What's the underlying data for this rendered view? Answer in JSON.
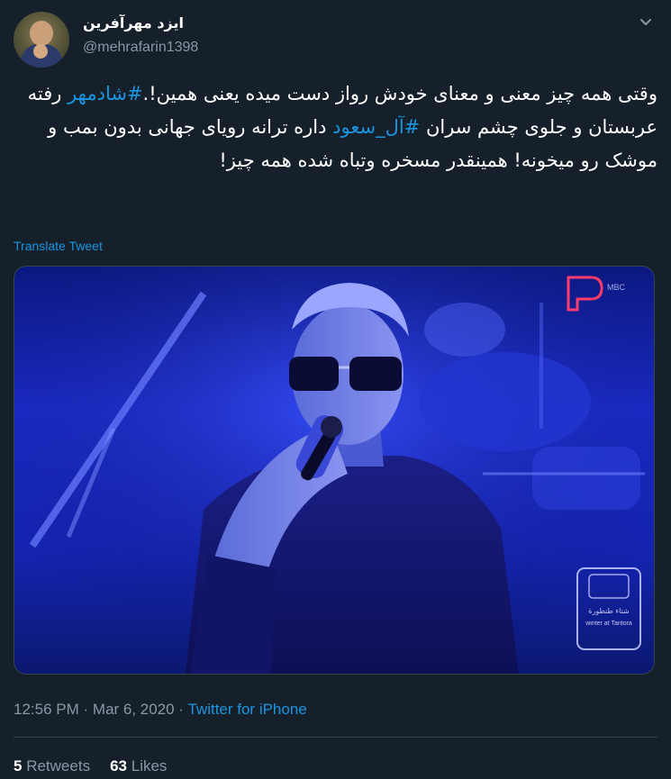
{
  "author": {
    "name": "ایزد مهرآفرین",
    "handle": "@mehrafarin1398"
  },
  "tweet": {
    "text_before_tag1": "وقتی همه چیز معنی و معنای خودش رواز دست میده یعنی همین!.",
    "hashtag1": "#شادمهر",
    "text_middle": " رفته عربستان و جلوی چشم سران ",
    "hashtag2": "#آل_سعود",
    "text_after": " داره ترانه رویای جهانی بدون بمب و موشک رو میخونه! همینقدر مسخره وتباه شده همه چیز!"
  },
  "translate_label": "Translate Tweet",
  "media": {
    "watermark_text": "MBC",
    "badge_text_line1": "شتاء طنطورة",
    "badge_text_line2": "winter at Tantora"
  },
  "meta": {
    "time": "12:56 PM",
    "separator": "·",
    "date": "Mar 6, 2020",
    "source": "Twitter for iPhone"
  },
  "stats": {
    "retweets_count": "5",
    "retweets_label": "Retweets",
    "likes_count": "63",
    "likes_label": "Likes"
  },
  "colors": {
    "background": "#15202b",
    "accent": "#1b95e0",
    "muted": "#8899a6",
    "border": "#38444d"
  }
}
